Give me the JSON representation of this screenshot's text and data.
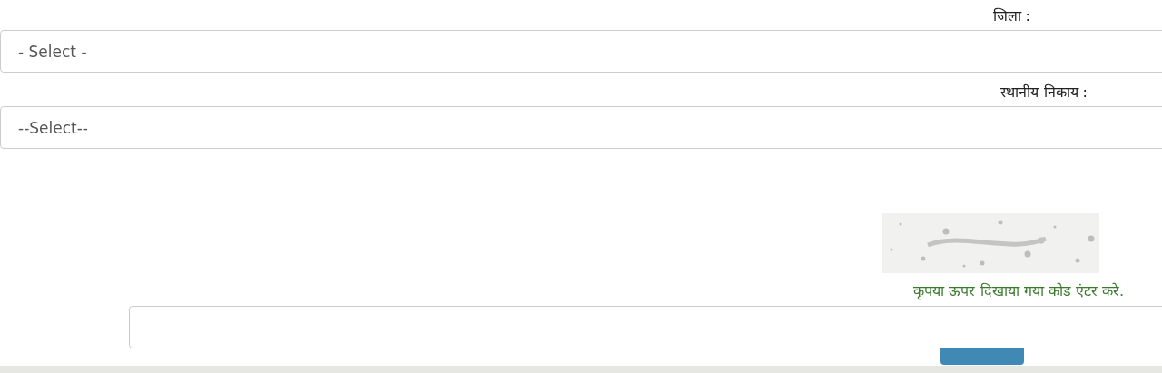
{
  "fields": [
    {
      "label": "जिला :",
      "value": "- Select -"
    },
    {
      "label": "स्थानीय निकाय :",
      "value": "--Select--"
    }
  ],
  "captcha": {
    "kind": "picture",
    "hint": "कृपया ऊपर दिखाया गया कोड एंटर करे."
  }
}
